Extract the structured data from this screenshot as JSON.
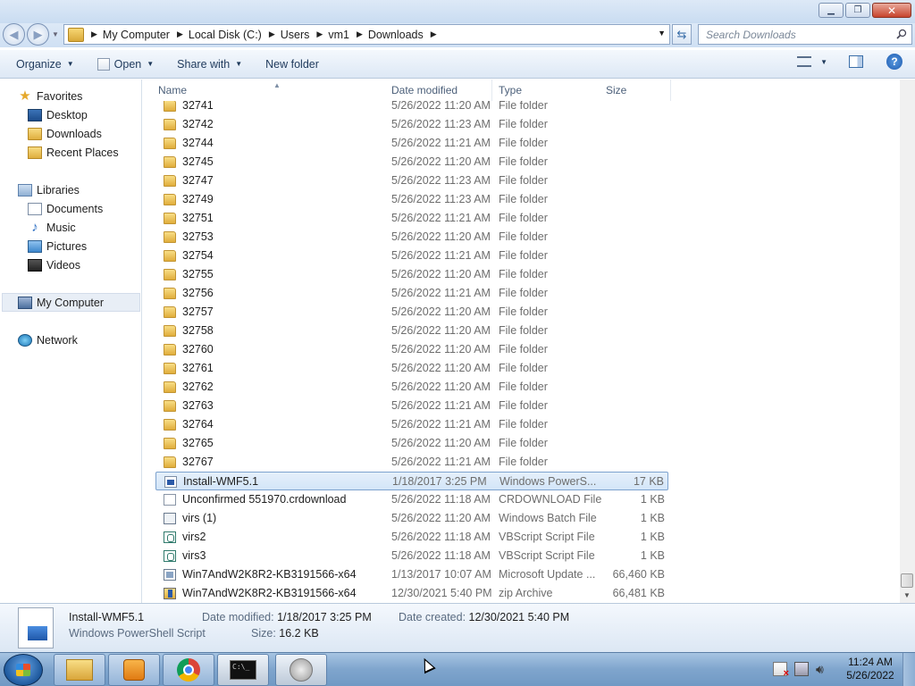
{
  "address": {
    "crumbs": [
      "My Computer",
      "Local Disk (C:)",
      "Users",
      "vm1",
      "Downloads"
    ]
  },
  "search": {
    "placeholder": "Search Downloads"
  },
  "toolbar": {
    "organize": "Organize",
    "open": "Open",
    "share_with": "Share with",
    "new_folder": "New folder"
  },
  "nav": {
    "favorites": "Favorites",
    "desktop": "Desktop",
    "downloads": "Downloads",
    "recent_places": "Recent Places",
    "libraries": "Libraries",
    "documents": "Documents",
    "music": "Music",
    "pictures": "Pictures",
    "videos": "Videos",
    "my_computer": "My Computer",
    "network": "Network"
  },
  "columns": {
    "name": "Name",
    "date_modified": "Date modified",
    "type": "Type",
    "size": "Size"
  },
  "files": [
    {
      "name": "32741",
      "date": "5/26/2022 11:20 AM",
      "type": "File folder",
      "size": "",
      "icon": "folder-icon"
    },
    {
      "name": "32742",
      "date": "5/26/2022 11:23 AM",
      "type": "File folder",
      "size": "",
      "icon": "folder-icon"
    },
    {
      "name": "32744",
      "date": "5/26/2022 11:21 AM",
      "type": "File folder",
      "size": "",
      "icon": "folder-icon"
    },
    {
      "name": "32745",
      "date": "5/26/2022 11:20 AM",
      "type": "File folder",
      "size": "",
      "icon": "folder-icon"
    },
    {
      "name": "32747",
      "date": "5/26/2022 11:23 AM",
      "type": "File folder",
      "size": "",
      "icon": "folder-icon"
    },
    {
      "name": "32749",
      "date": "5/26/2022 11:23 AM",
      "type": "File folder",
      "size": "",
      "icon": "folder-icon"
    },
    {
      "name": "32751",
      "date": "5/26/2022 11:21 AM",
      "type": "File folder",
      "size": "",
      "icon": "folder-icon"
    },
    {
      "name": "32753",
      "date": "5/26/2022 11:20 AM",
      "type": "File folder",
      "size": "",
      "icon": "folder-icon"
    },
    {
      "name": "32754",
      "date": "5/26/2022 11:21 AM",
      "type": "File folder",
      "size": "",
      "icon": "folder-icon"
    },
    {
      "name": "32755",
      "date": "5/26/2022 11:20 AM",
      "type": "File folder",
      "size": "",
      "icon": "folder-icon"
    },
    {
      "name": "32756",
      "date": "5/26/2022 11:21 AM",
      "type": "File folder",
      "size": "",
      "icon": "folder-icon"
    },
    {
      "name": "32757",
      "date": "5/26/2022 11:20 AM",
      "type": "File folder",
      "size": "",
      "icon": "folder-icon"
    },
    {
      "name": "32758",
      "date": "5/26/2022 11:20 AM",
      "type": "File folder",
      "size": "",
      "icon": "folder-icon"
    },
    {
      "name": "32760",
      "date": "5/26/2022 11:20 AM",
      "type": "File folder",
      "size": "",
      "icon": "folder-icon"
    },
    {
      "name": "32761",
      "date": "5/26/2022 11:20 AM",
      "type": "File folder",
      "size": "",
      "icon": "folder-icon"
    },
    {
      "name": "32762",
      "date": "5/26/2022 11:20 AM",
      "type": "File folder",
      "size": "",
      "icon": "folder-icon"
    },
    {
      "name": "32763",
      "date": "5/26/2022 11:21 AM",
      "type": "File folder",
      "size": "",
      "icon": "folder-icon"
    },
    {
      "name": "32764",
      "date": "5/26/2022 11:21 AM",
      "type": "File folder",
      "size": "",
      "icon": "folder-icon"
    },
    {
      "name": "32765",
      "date": "5/26/2022 11:20 AM",
      "type": "File folder",
      "size": "",
      "icon": "folder-icon"
    },
    {
      "name": "32767",
      "date": "5/26/2022 11:21 AM",
      "type": "File folder",
      "size": "",
      "icon": "folder-icon"
    },
    {
      "name": "Install-WMF5.1",
      "date": "1/18/2017 3:25 PM",
      "type": "Windows PowerS...",
      "size": "17 KB",
      "icon": "powershell-script-icon",
      "selected": true
    },
    {
      "name": "Unconfirmed 551970.crdownload",
      "date": "5/26/2022 11:18 AM",
      "type": "CRDOWNLOAD File",
      "size": "1 KB",
      "icon": "file-icon"
    },
    {
      "name": "virs (1)",
      "date": "5/26/2022 11:20 AM",
      "type": "Windows Batch File",
      "size": "1 KB",
      "icon": "batch-file-icon"
    },
    {
      "name": "virs2",
      "date": "5/26/2022 11:18 AM",
      "type": "VBScript Script File",
      "size": "1 KB",
      "icon": "vbscript-file-icon"
    },
    {
      "name": "virs3",
      "date": "5/26/2022 11:18 AM",
      "type": "VBScript Script File",
      "size": "1 KB",
      "icon": "vbscript-file-icon"
    },
    {
      "name": "Win7AndW2K8R2-KB3191566-x64",
      "date": "1/13/2017 10:07 AM",
      "type": "Microsoft Update ...",
      "size": "66,460 KB",
      "icon": "update-package-icon"
    },
    {
      "name": "Win7AndW2K8R2-KB3191566-x64",
      "date": "12/30/2021 5:40 PM",
      "type": "zip Archive",
      "size": "66,481 KB",
      "icon": "zip-archive-icon"
    }
  ],
  "details": {
    "name": "Install-WMF5.1",
    "type": "Windows PowerShell Script",
    "date_modified_label": "Date modified:",
    "date_modified": "1/18/2017 3:25 PM",
    "size_label": "Size:",
    "size": "16.2 KB",
    "date_created_label": "Date created:",
    "date_created": "12/30/2021 5:40 PM"
  },
  "taskbar": {
    "clock_time": "11:24 AM",
    "clock_date": "5/26/2022",
    "cmd_glyph": "C:\\_"
  }
}
